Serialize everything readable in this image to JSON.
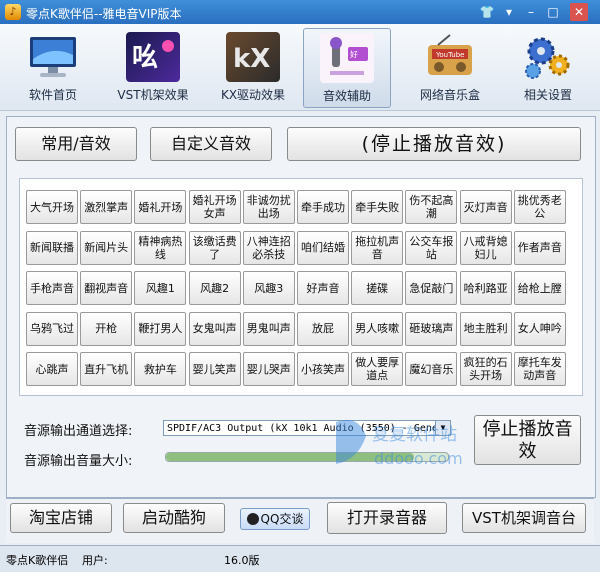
{
  "window": {
    "title": "零点K歌伴侣--雅电音VIP版本",
    "icon": "app-icon"
  },
  "toolbar": {
    "items": [
      {
        "label": "软件首页",
        "icon": "monitor-icon"
      },
      {
        "label": "VST机架效果",
        "icon": "vst-icon"
      },
      {
        "label": "KX驱动效果",
        "icon": "kx-icon"
      },
      {
        "label": "音效辅助",
        "icon": "microphone-icon"
      },
      {
        "label": "网络音乐盒",
        "icon": "radio-icon"
      },
      {
        "label": "相关设置",
        "icon": "gears-icon"
      }
    ]
  },
  "tabs": {
    "common": "常用/音效",
    "custom": "自定义音效",
    "stop_all": "(停止播放音效)"
  },
  "effects": [
    [
      "大气开场",
      "激烈掌声",
      "婚礼开场",
      "婚礼开场女声",
      "非诚勿扰出场",
      "牵手成功",
      "牵手失败",
      "伤不起高潮",
      "灭灯声音",
      "挑优秀老公"
    ],
    [
      "新闻联播",
      "新闻片头",
      "精神病热线",
      "该缴话费了",
      "八神连招必杀技",
      "咱们结婚",
      "拖拉机声音",
      "公交车报站",
      "八戒背媳妇儿",
      "作者声音"
    ],
    [
      "手枪声音",
      "翻视声音",
      "风趣1",
      "风趣2",
      "风趣3",
      "好声音",
      "搓碟",
      "急促敲门",
      "哈利路亚",
      "给枪上膛"
    ],
    [
      "乌鸦飞过",
      "开枪",
      "鞭打男人",
      "女鬼叫声",
      "男鬼叫声",
      "放屁",
      "男人咳嗽",
      "砸玻璃声",
      "地主胜利",
      "女人呻吟"
    ],
    [
      "心跳声",
      "直升飞机",
      "救护车",
      "婴儿笑声",
      "婴儿哭声",
      "小孩笑声",
      "做人要厚道点",
      "魔幻音乐",
      "疯狂的石头开场",
      "摩托车发动声音"
    ]
  ],
  "output": {
    "channel_label": "音源输出通道选择:",
    "channel_value": "SPDIF/AC3 Output (kX 10k1 Audio (3550) - Gener",
    "volume_label": "音源输出音量大小:",
    "volume_level": 0.88,
    "stop_button": "停止播放音效"
  },
  "watermark": {
    "cn": "复复软件站",
    "url": "ddooo.com"
  },
  "bottom": {
    "shop": "淘宝店铺",
    "kugou": "启动酷狗",
    "qq": "QQ交谈",
    "recorder": "打开录音器",
    "vst": "VST机架调音台"
  },
  "status": {
    "app": "零点K歌伴侣",
    "user_label": "用户:",
    "version": "16.0版"
  },
  "colors": {
    "titlebar": "#2a6fc0",
    "accent": "#3f8fd9",
    "panel": "#f0f3f7",
    "status": "#dde5ef"
  }
}
